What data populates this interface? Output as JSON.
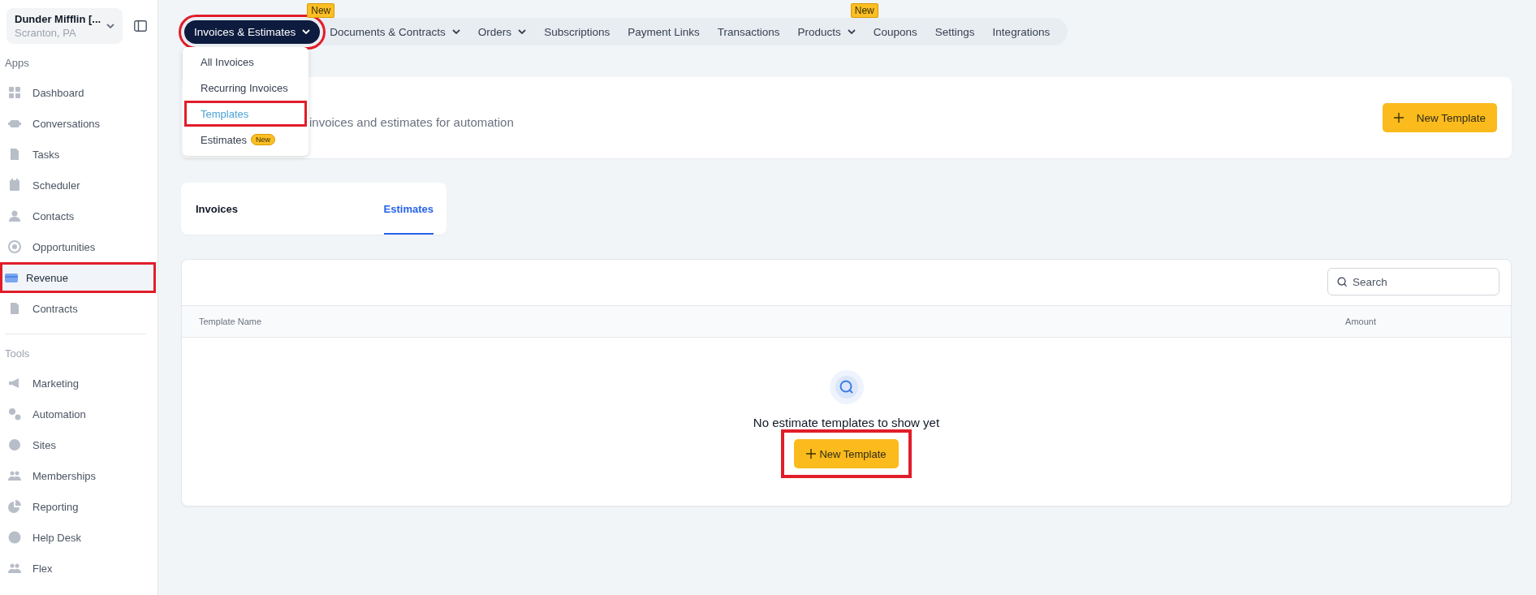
{
  "sidebar": {
    "account": {
      "name": "Dunder Mifflin [...",
      "location": "Scranton, PA"
    },
    "sections": [
      {
        "title": "Apps",
        "items": [
          {
            "label": "Dashboard",
            "selected": false,
            "highlighted": false
          },
          {
            "label": "Conversations",
            "selected": false,
            "highlighted": false
          },
          {
            "label": "Tasks",
            "selected": false,
            "highlighted": false
          },
          {
            "label": "Scheduler",
            "selected": false,
            "highlighted": false
          },
          {
            "label": "Contacts",
            "selected": false,
            "highlighted": false
          },
          {
            "label": "Opportunities",
            "selected": false,
            "highlighted": false
          },
          {
            "label": "Revenue",
            "selected": true,
            "highlighted": true
          },
          {
            "label": "Contracts",
            "selected": false,
            "highlighted": false
          }
        ]
      },
      {
        "title": "Tools",
        "items": [
          {
            "label": "Marketing",
            "selected": false,
            "highlighted": false
          },
          {
            "label": "Automation",
            "selected": false,
            "highlighted": false
          },
          {
            "label": "Sites",
            "selected": false,
            "highlighted": false
          },
          {
            "label": "Memberships",
            "selected": false,
            "highlighted": false
          },
          {
            "label": "Reporting",
            "selected": false,
            "highlighted": false
          },
          {
            "label": "Help Desk",
            "selected": false,
            "highlighted": false
          },
          {
            "label": "Flex",
            "selected": false,
            "highlighted": false
          }
        ]
      }
    ]
  },
  "top_nav": [
    {
      "label": "Invoices & Estimates",
      "selected": true,
      "has_menu": true,
      "badge": "New",
      "highlighted": true
    },
    {
      "label": "Documents & Contracts",
      "selected": false,
      "has_menu": true,
      "highlighted": false
    },
    {
      "label": "Orders",
      "selected": false,
      "has_menu": true,
      "highlighted": false
    },
    {
      "label": "Subscriptions",
      "selected": false,
      "has_menu": false,
      "highlighted": false
    },
    {
      "label": "Payment Links",
      "selected": false,
      "has_menu": false,
      "highlighted": false
    },
    {
      "label": "Transactions",
      "selected": false,
      "has_menu": false,
      "highlighted": false
    },
    {
      "label": "Products",
      "selected": false,
      "has_menu": true,
      "badge": "New",
      "highlighted": false
    },
    {
      "label": "Coupons",
      "selected": false,
      "has_menu": false,
      "highlighted": false
    },
    {
      "label": "Settings",
      "selected": false,
      "has_menu": false,
      "highlighted": false
    },
    {
      "label": "Integrations",
      "selected": false,
      "has_menu": false,
      "highlighted": false
    }
  ],
  "dropdown": {
    "items": [
      {
        "label": "All Invoices",
        "selected": false,
        "highlighted": false
      },
      {
        "label": "Recurring Invoices",
        "selected": false,
        "highlighted": false
      },
      {
        "label": "Templates",
        "selected": true,
        "highlighted": true
      },
      {
        "label": "Estimates",
        "selected": false,
        "highlighted": false,
        "badge": "New"
      }
    ]
  },
  "header_card": {
    "description": "invoices and estimates for automation",
    "button": {
      "label": "New Template"
    }
  },
  "tabs": [
    {
      "label": "Invoices",
      "selected": false
    },
    {
      "label": "Estimates",
      "selected": true
    }
  ],
  "table": {
    "search": {
      "placeholder": "Search"
    },
    "columns": [
      "Template Name",
      "Amount"
    ],
    "empty_state": {
      "message": "No estimate templates to show yet",
      "button": {
        "label": "New Template",
        "highlighted": true
      }
    }
  }
}
